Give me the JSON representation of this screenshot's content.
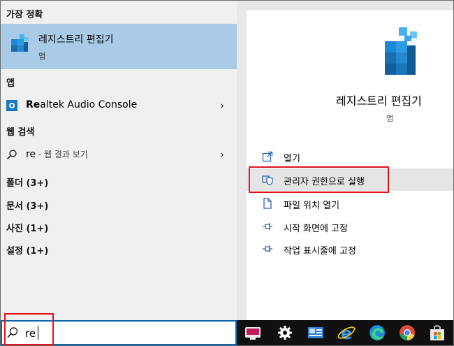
{
  "left": {
    "best_match_header": "가장 정확",
    "best_match": {
      "title": "레지스트리 편집기",
      "type": "앱"
    },
    "apps_header": "앱",
    "app_result": {
      "label_bold": "Re",
      "label_rest": "altek Audio Console",
      "chevron": "›"
    },
    "web_header": "웹 검색",
    "web_result": {
      "query": "re",
      "suffix": " - 웹 결과 보기",
      "chevron": "›"
    },
    "categories": [
      "폴더 (3+)",
      "문서 (3+)",
      "사진 (1+)",
      "설정 (1+)"
    ]
  },
  "search": {
    "value": "re"
  },
  "right": {
    "app_name": "레지스트리 편집기",
    "app_type": "앱",
    "actions": [
      {
        "label": "열기",
        "icon": "open-icon"
      },
      {
        "label": "관리자 권한으로 실행",
        "icon": "shield-admin-icon"
      },
      {
        "label": "파일 위치 열기",
        "icon": "file-location-icon"
      },
      {
        "label": "시작 화면에 고정",
        "icon": "pin-icon"
      },
      {
        "label": "작업 표시줄에 고정",
        "icon": "pin-icon"
      }
    ]
  },
  "taskbar": {
    "icons": [
      "chat-app-icon",
      "settings-gear-icon",
      "contact-card-icon",
      "internet-explorer-icon",
      "edge-icon",
      "chrome-icon",
      "store-icon"
    ]
  },
  "colors": {
    "highlight": "#a9cbe8",
    "accent_blue": "#0a64ad",
    "annotation_red": "#e1141c",
    "taskbar": "#101010"
  }
}
